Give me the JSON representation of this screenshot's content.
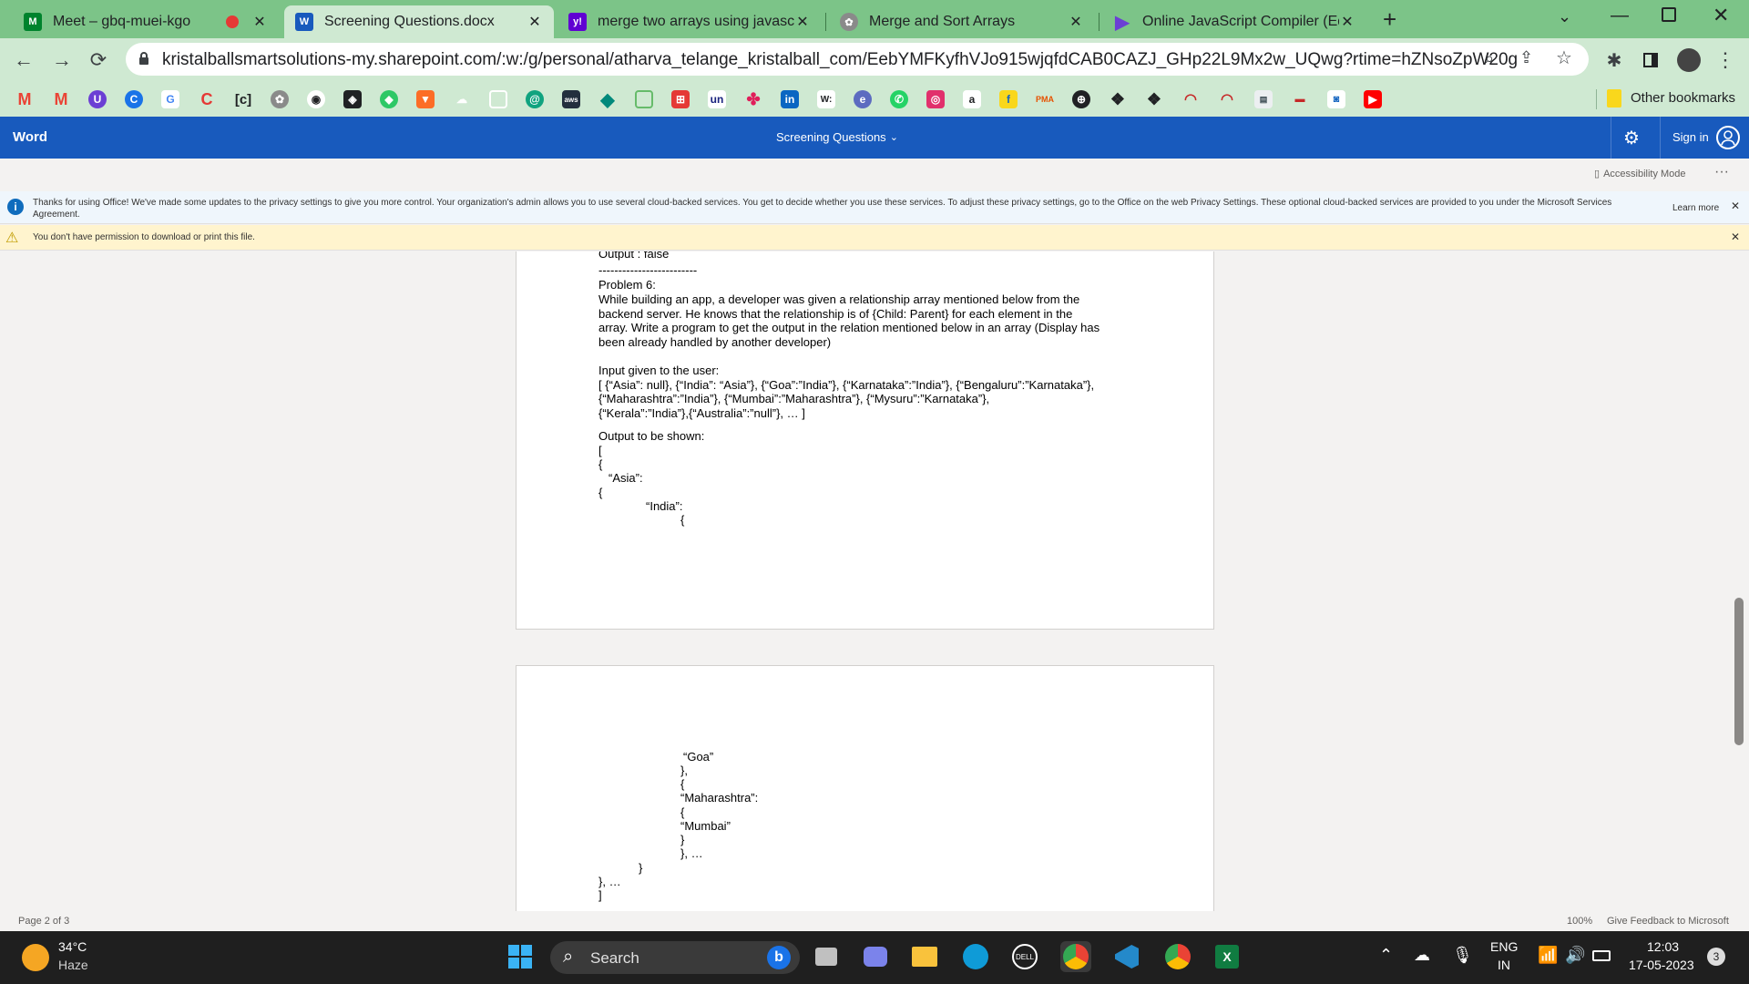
{
  "browser": {
    "tabs": [
      {
        "title": "Meet – gbq-muei-kgo",
        "icon": "google-meet-icon",
        "color": "#00832d"
      },
      {
        "title": "Screening Questions.docx",
        "icon": "word-icon",
        "color": "#185abd"
      },
      {
        "title": "merge two arrays using javascrip",
        "icon": "yahoo-icon",
        "color": "#6001d2"
      },
      {
        "title": "Merge and Sort Arrays",
        "icon": "chatgpt-icon",
        "color": "#5a5a5a"
      },
      {
        "title": "Online JavaScript Compiler (Edito",
        "icon": "programiz-icon",
        "color": "#6b3fd4"
      }
    ],
    "url": "kristalballsmartsolutions-my.sharepoint.com/:w:/g/personal/atharva_telange_kristalball_com/EebYMFKyfhVJo915wjqfdCAB0CAZJ_GHp22L9Mx2w_UQwg?rtime=hZNsoZpW20g",
    "other_bookmarks": "Other bookmarks"
  },
  "word": {
    "app_name": "Word",
    "doc_title": "Screening Questions",
    "sign_in": "Sign in",
    "accessibility_mode": "Accessibility Mode",
    "privacy_notice": "Thanks for using Office! We've made some updates to the privacy settings to give you more control. Your organization's admin allows you to use several cloud-backed services. You get to decide whether you use these services. To adjust these privacy settings, go to the Office on the web Privacy Settings. These optional cloud-backed services are provided to you under the Microsoft Services Agreement.",
    "learn_more": "Learn more",
    "permission_warning": "You don't have permission to download or print this file.",
    "page_indicator": "Page 2 of 3",
    "zoom": "100%",
    "feedback": "Give Feedback to Microsoft"
  },
  "document": {
    "page1_lines": [
      "Output : false",
      "-------------------------",
      "Problem 6:",
      "While building an app, a developer was given a relationship array mentioned below from the",
      "backend server. He knows that the relationship is of {Child: Parent} for each element in the",
      "array. Write a program to get the output in the relation mentioned below in an array (Display has",
      "been already handled by another developer)",
      "Input given to the user:",
      "[ {“Asia”: null}, {“India”: “Asia”}, {“Goa”:”India”}, {“Karnataka”:”India”}, {“Bengaluru”:”Karnataka”},",
      "{“Maharashtra”:”India”}, {“Mumbai”:”Maharashtra”}, {“Mysuru”:”Karnataka”},",
      "{“Kerala”:”India”},{“Australia”:”null”}, … ]",
      "Output to be shown:",
      "[",
      "{",
      "“Asia”:",
      "{",
      "“India”:",
      "{"
    ],
    "page2_lines": [
      "“Goa”",
      "},",
      "{",
      "“Maharashtra”:",
      "{",
      "“Mumbai”",
      "}",
      "}, …",
      "}",
      "}, …",
      "]"
    ]
  },
  "taskbar": {
    "temperature": "34°C",
    "weather": "Haze",
    "search_placeholder": "Search",
    "lang_line1": "ENG",
    "lang_line2": "IN",
    "time": "12:03",
    "date": "17-05-2023",
    "notification_count": "3"
  }
}
